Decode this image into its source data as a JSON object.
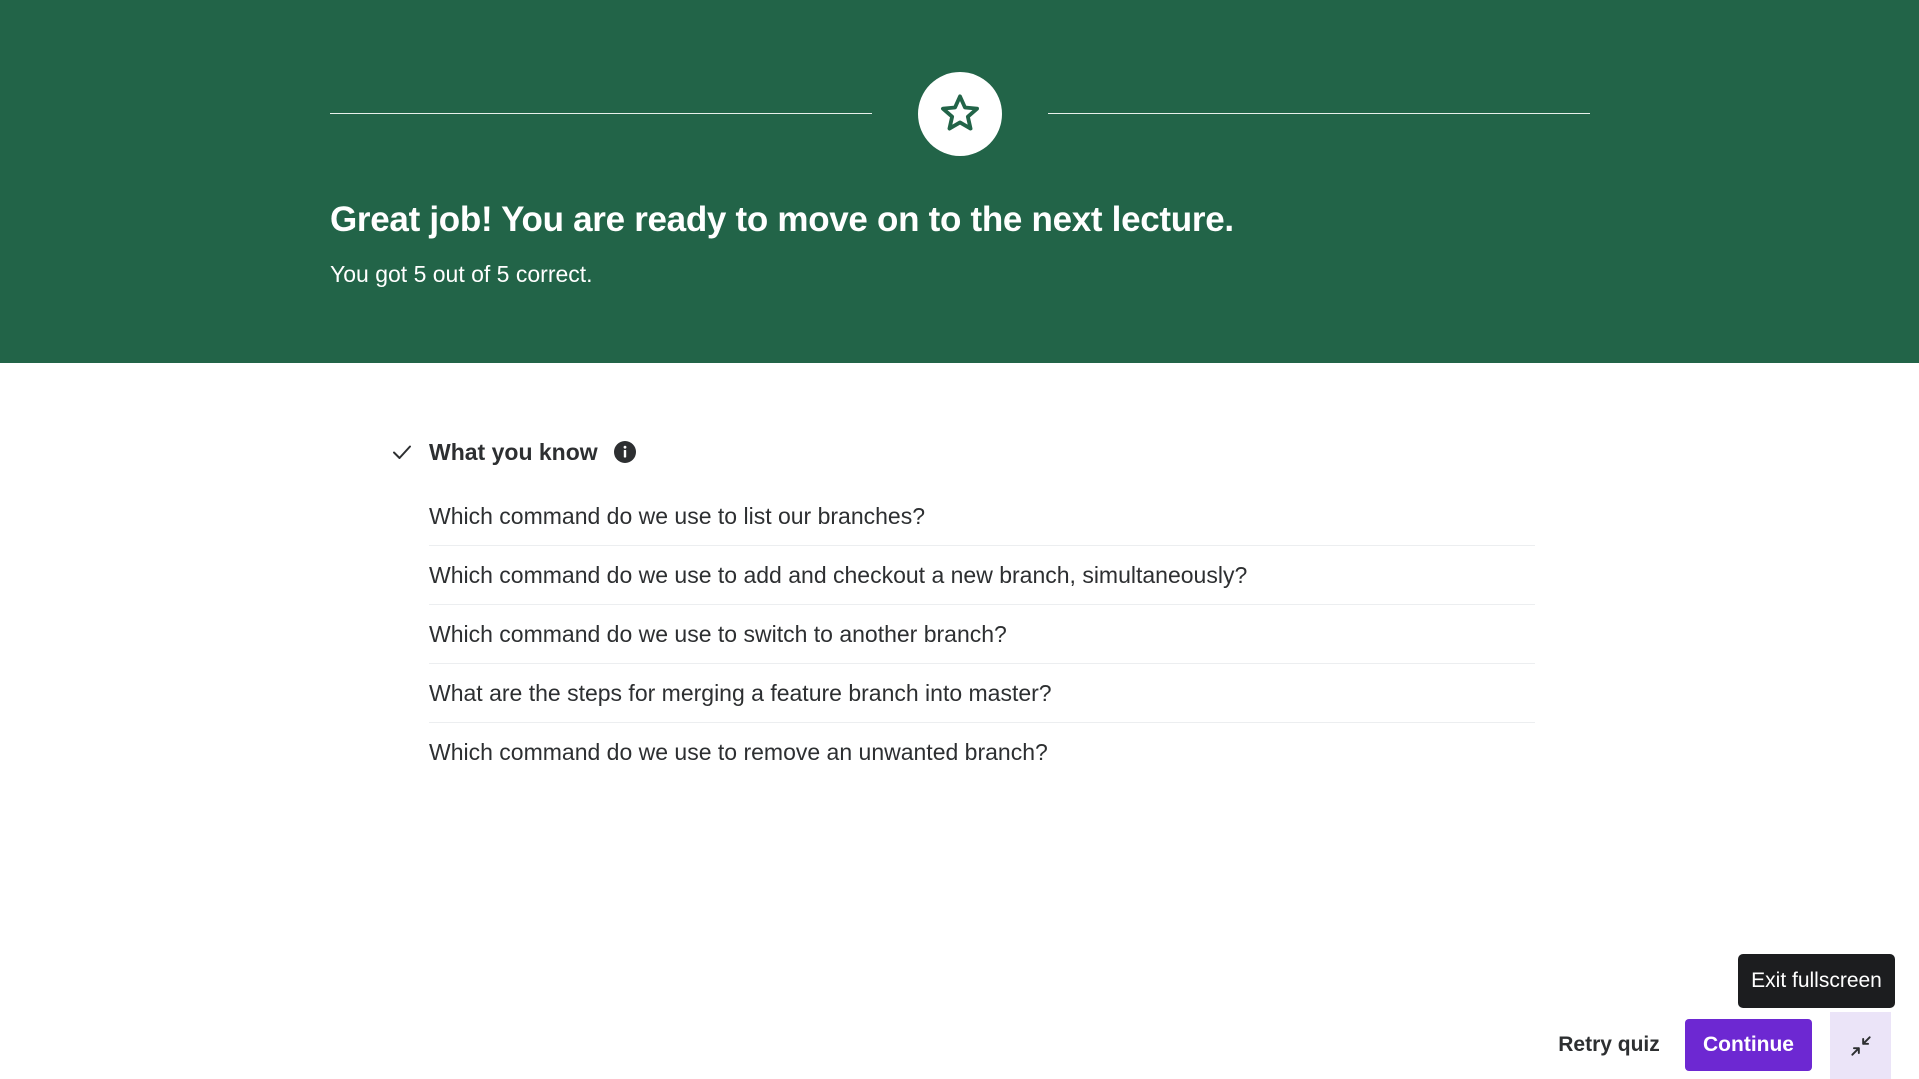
{
  "banner": {
    "title": "Great job! You are ready to move on to the next lecture.",
    "subtitle": "You got 5 out of 5 correct.",
    "icon": "star-icon",
    "background_color": "#226448"
  },
  "section": {
    "title": "What you know",
    "status_icon": "checkmark-icon",
    "info_icon": "info-icon"
  },
  "questions": [
    "Which command do we use to list our branches?",
    "Which command do we use to add and checkout a new branch, simultaneously?",
    "Which command do we use to switch to another branch?",
    "What are the steps for merging a feature branch into master?",
    "Which command do we use to remove an unwanted branch?"
  ],
  "footer": {
    "retry_label": "Retry quiz",
    "continue_label": "Continue",
    "tooltip": "Exit fullscreen",
    "fullscreen_icon": "exit-fullscreen-icon",
    "accent_color": "#6d28d2"
  }
}
